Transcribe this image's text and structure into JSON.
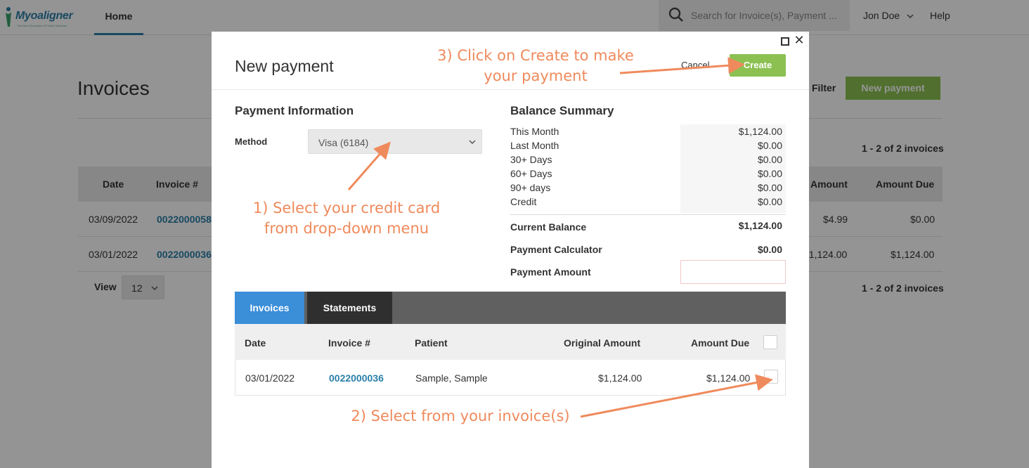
{
  "app": {
    "logo_text": "Myoaligner",
    "logo_tagline": "The New Generation Of Smile Solutions",
    "nav_home": "Home",
    "search_placeholder": "Search for Invoice(s), Payment ...",
    "user_name": "Jon Doe",
    "help": "Help"
  },
  "page": {
    "title": "Invoices",
    "filter": "Filter",
    "new_payment": "New payment",
    "count_top": "1 - 2 of 2 invoices",
    "count_bottom": "1 - 2 of 2 invoices",
    "view_label": "View",
    "view_value": "12",
    "table": {
      "headers": {
        "date": "Date",
        "invoice": "Invoice #",
        "amount": "Amount",
        "amount_due": "Amount Due"
      },
      "rows": [
        {
          "date": "03/09/2022",
          "invoice": "0022000058",
          "amount": "$4.99",
          "amount_due": "$0.00"
        },
        {
          "date": "03/01/2022",
          "invoice": "0022000036",
          "amount": "$1,124.00",
          "amount_due": "$1,124.00"
        }
      ]
    }
  },
  "modal": {
    "title": "New payment",
    "cancel": "Cancel",
    "create": "Create",
    "payment_info": {
      "heading": "Payment Information",
      "method_label": "Method",
      "method_value": "Visa (6184)"
    },
    "balance": {
      "heading": "Balance Summary",
      "rows": [
        {
          "label": "This Month",
          "value": "$1,124.00"
        },
        {
          "label": "Last Month",
          "value": "$0.00"
        },
        {
          "label": "30+ Days",
          "value": "$0.00"
        },
        {
          "label": "60+ Days",
          "value": "$0.00"
        },
        {
          "label": "90+ days",
          "value": "$0.00"
        },
        {
          "label": "Credit",
          "value": "$0.00"
        }
      ],
      "current_balance_label": "Current Balance",
      "current_balance_value": "$1,124.00",
      "calculator_label": "Payment Calculator",
      "calculator_value": "$0.00",
      "payment_amount_label": "Payment Amount"
    },
    "tabs": [
      "Invoices",
      "Statements"
    ],
    "invoices": {
      "headers": {
        "date": "Date",
        "invoice": "Invoice #",
        "patient": "Patient",
        "original": "Original Amount",
        "amount_due": "Amount Due"
      },
      "rows": [
        {
          "date": "03/01/2022",
          "invoice": "0022000036",
          "patient": "Sample, Sample",
          "original": "$1,124.00",
          "amount_due": "$1,124.00"
        }
      ]
    }
  },
  "annotations": {
    "step1_line1": "1) Select your credit card",
    "step1_line2": "from drop-down menu",
    "step2": "2) Select from your invoice(s)",
    "step3_line1": "3) Click on Create to make",
    "step3_line2": "your payment"
  },
  "colors": {
    "accent_blue": "#3b8ed8",
    "link_blue": "#2a7fa8",
    "create_green": "#8cc152",
    "annotation_orange": "#ef8a5c"
  },
  "icons": [
    "search-icon",
    "chevron-down-icon",
    "maximize-icon",
    "close-icon"
  ]
}
